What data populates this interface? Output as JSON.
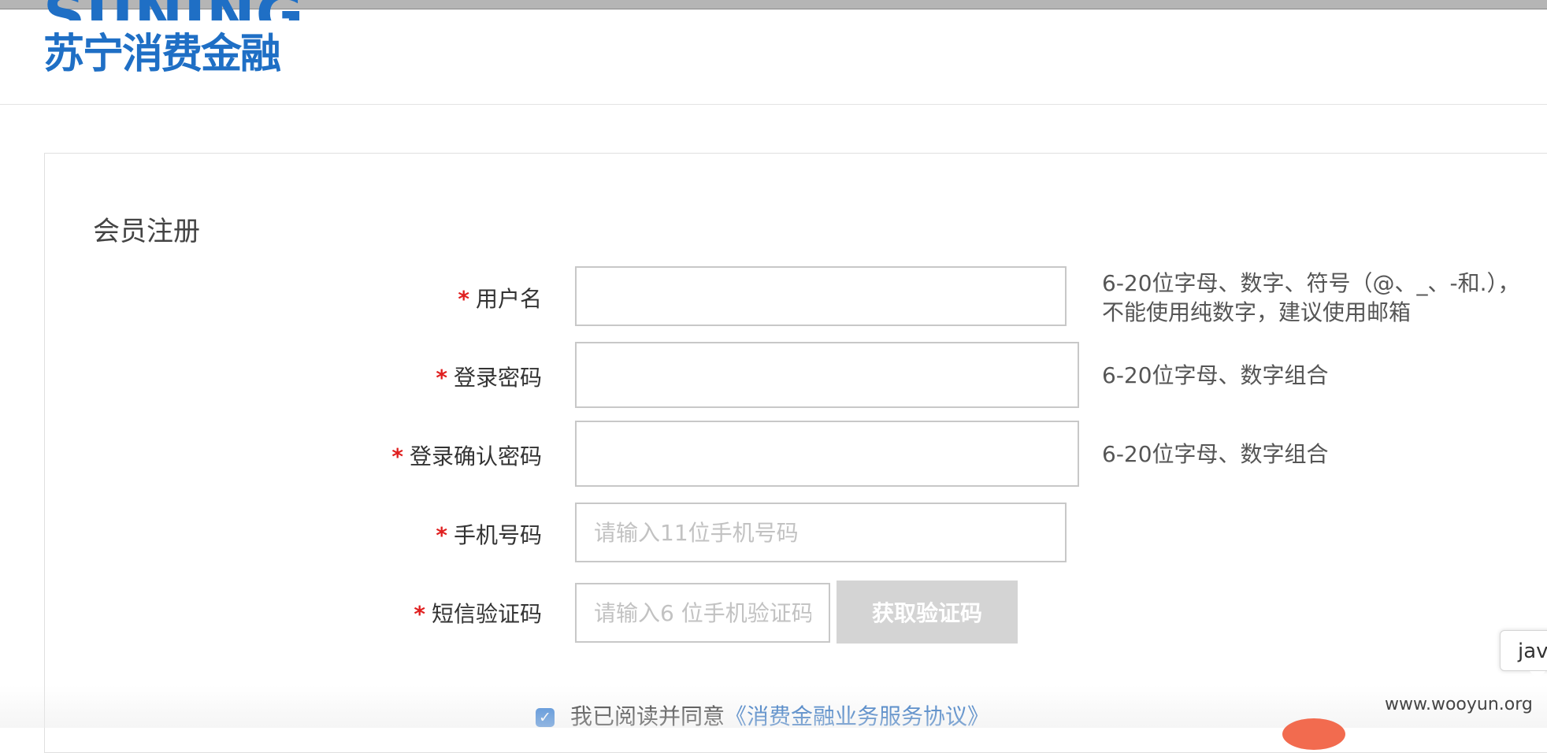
{
  "brand": {
    "logo_en": "SUNING",
    "logo_cn": "苏宁消费金融"
  },
  "form": {
    "title": "会员注册",
    "required_mark": "*",
    "fields": [
      {
        "label": "用户名",
        "value": "",
        "placeholder": "",
        "hint_line1": "6-20位字母、数字、符号（@、_、-和.），",
        "hint_line2": "不能使用纯数字，建议使用邮箱"
      },
      {
        "label": "登录密码",
        "value": "",
        "placeholder": "",
        "hint_line1": "6-20位字母、数字组合"
      },
      {
        "label": "登录确认密码",
        "value": "",
        "placeholder": "",
        "hint_line1": "6-20位字母、数字组合"
      },
      {
        "label": "手机号码",
        "value": "",
        "placeholder": "请输入11位手机号码"
      },
      {
        "label": "短信验证码",
        "value": "",
        "placeholder": "请输入6 位手机验证码"
      }
    ],
    "sms_button_label": "获取验证码",
    "agree_text": "我已阅读并同意",
    "agree_link": "《消费金融业务服务协议》",
    "agree_checked": true
  },
  "tooltip_text": "jav",
  "watermark": "www.wooyun.org",
  "colors": {
    "brand_blue": "#1f6fc5",
    "required_red": "#e02020",
    "link_blue": "#2b6fbf",
    "disabled_button": "#d4d4d4"
  }
}
